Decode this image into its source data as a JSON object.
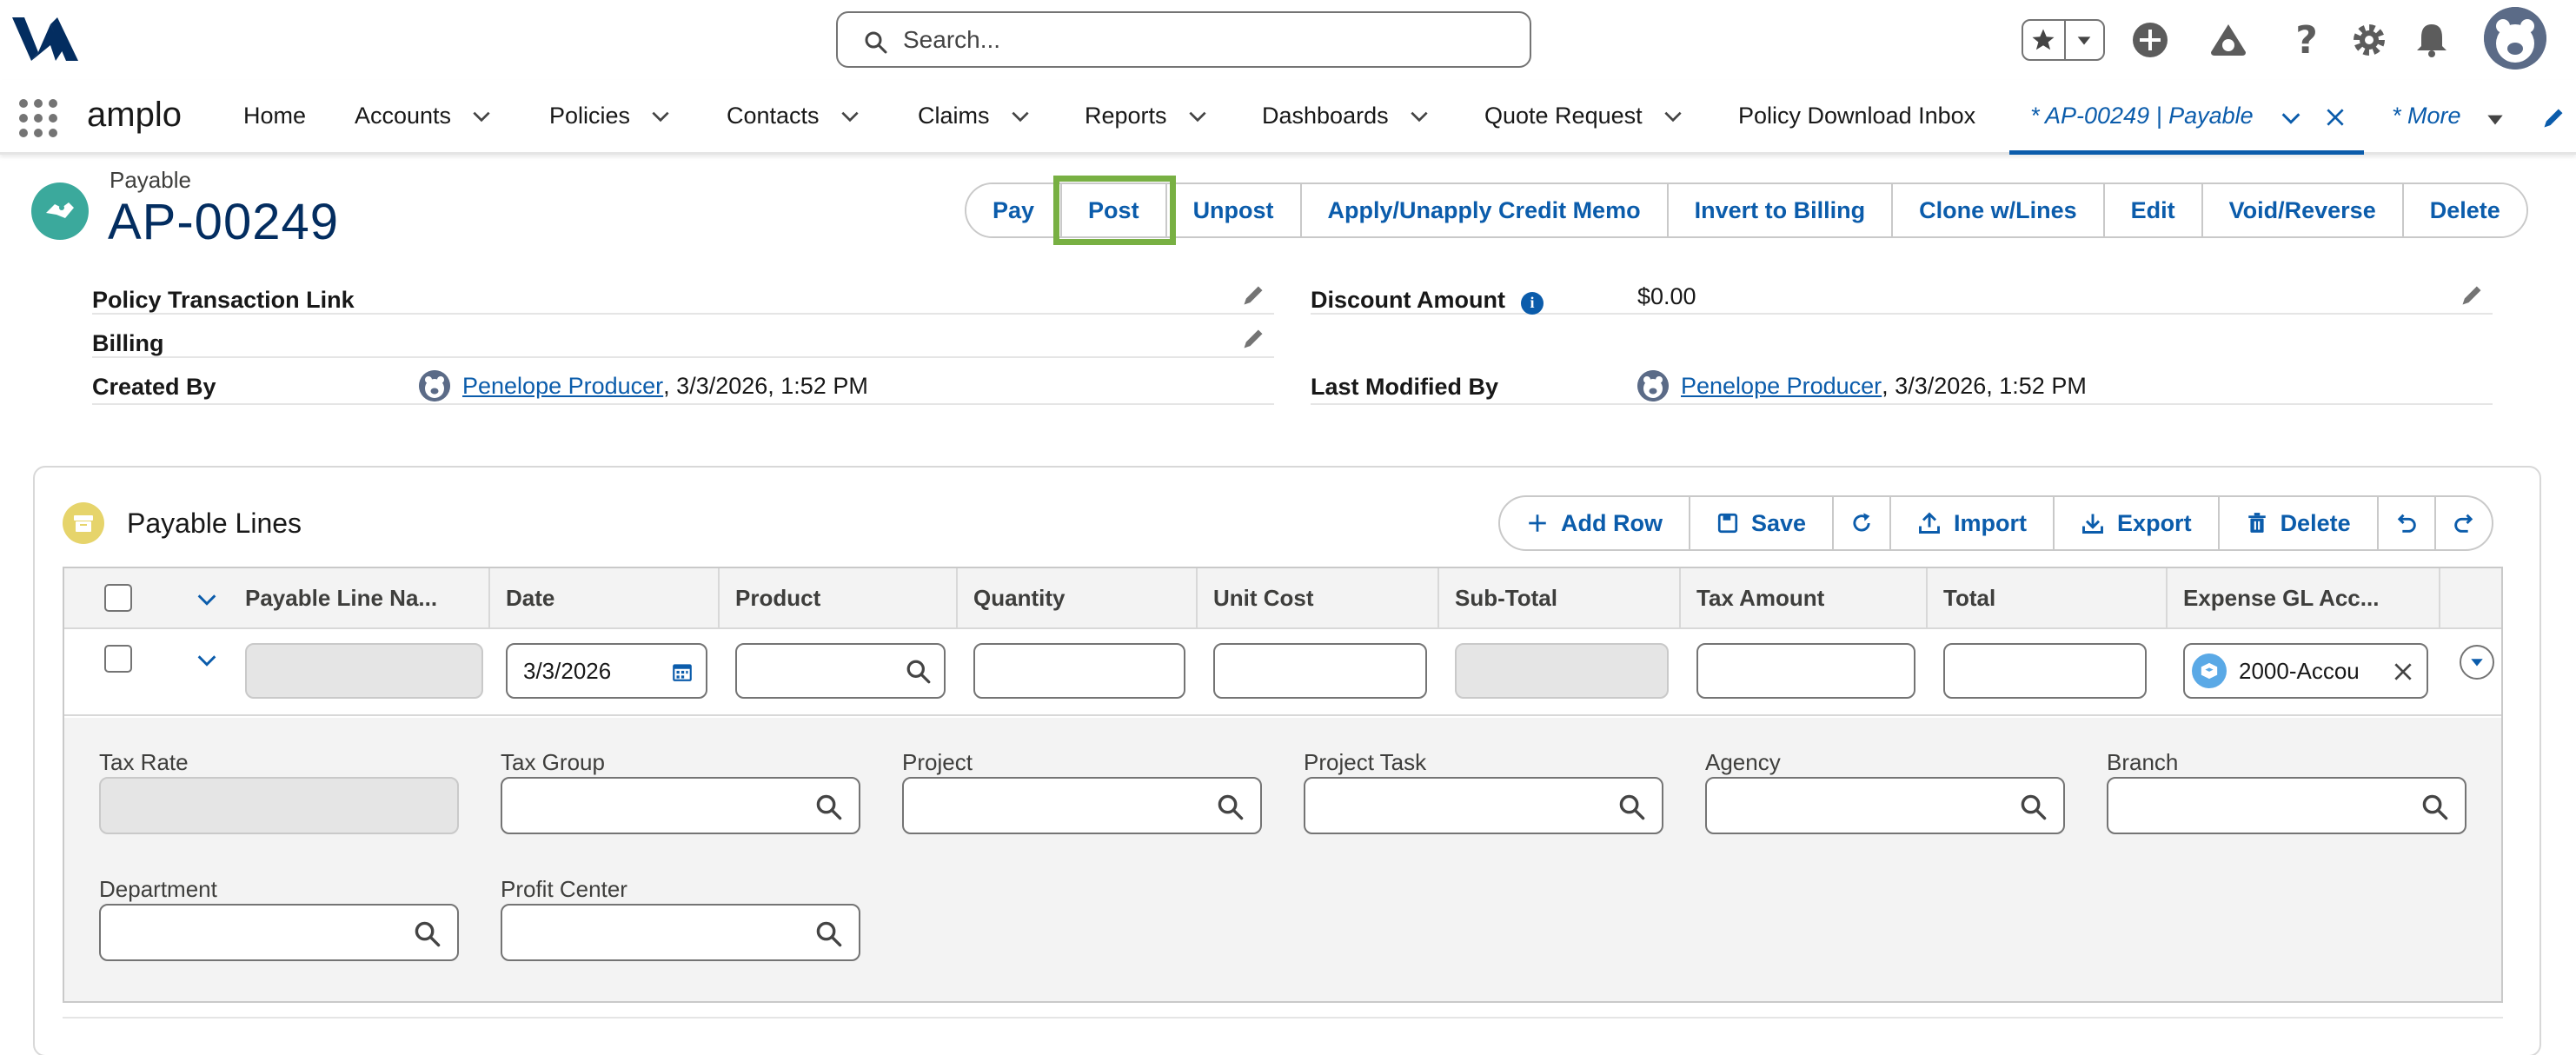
{
  "header": {
    "search_placeholder": "Search..."
  },
  "nav": {
    "app_name": "amplo",
    "items": [
      {
        "label": "Home"
      },
      {
        "label": "Accounts"
      },
      {
        "label": "Policies"
      },
      {
        "label": "Contacts"
      },
      {
        "label": "Claims"
      },
      {
        "label": "Reports"
      },
      {
        "label": "Dashboards"
      },
      {
        "label": "Quote Request"
      },
      {
        "label": "Policy Download Inbox"
      }
    ],
    "active_tab": "* AP-00249 | Payable",
    "more": "* More"
  },
  "record": {
    "type": "Payable",
    "name": "AP-00249",
    "actions": [
      "Pay",
      "Post",
      "Unpost",
      "Apply/Unapply Credit Memo",
      "Invert to Billing",
      "Clone w/Lines",
      "Edit",
      "Void/Reverse",
      "Delete"
    ]
  },
  "details": {
    "policy_transaction_link": {
      "label": "Policy Transaction Link",
      "value": ""
    },
    "billing": {
      "label": "Billing",
      "value": ""
    },
    "created_by": {
      "label": "Created By",
      "user": "Penelope Producer",
      "date": ", 3/3/2026, 1:52 PM"
    },
    "discount_amount": {
      "label": "Discount Amount",
      "value": "$0.00"
    },
    "last_modified_by": {
      "label": "Last Modified By",
      "user": "Penelope Producer",
      "date": ", 3/3/2026, 1:52 PM"
    }
  },
  "lines": {
    "title": "Payable Lines",
    "toolbar": {
      "add_row": "Add Row",
      "save": "Save",
      "import": "Import",
      "export": "Export",
      "delete": "Delete"
    },
    "columns": [
      "Payable Line Na...",
      "Date",
      "Product",
      "Quantity",
      "Unit Cost",
      "Sub-Total",
      "Tax Amount",
      "Total",
      "Expense GL Acc..."
    ],
    "row": {
      "date": "3/3/2026",
      "expense_gl": "2000-Accou"
    },
    "fields": {
      "tax_rate": "Tax Rate",
      "tax_group": "Tax Group",
      "project": "Project",
      "project_task": "Project Task",
      "agency": "Agency",
      "branch": "Branch",
      "department": "Department",
      "profit_center": "Profit Center"
    }
  },
  "colors": {
    "brand_blue": "#0b5cab",
    "title_navy": "#032d60",
    "highlight_green": "#78b043",
    "record_icon_teal": "#3ba99c",
    "lines_icon_yellow": "#e6d46b"
  },
  "icons": [
    "logo",
    "search-icon",
    "star-icon",
    "chevron-down-icon",
    "plus-circle-icon",
    "trailhead-icon",
    "help-icon",
    "gear-icon",
    "bell-icon",
    "avatar",
    "app-launcher-icon",
    "close-icon",
    "pencil-icon",
    "info-icon",
    "calendar-icon",
    "refresh-icon",
    "upload-icon",
    "download-icon",
    "trash-icon",
    "undo-icon",
    "redo-icon"
  ]
}
